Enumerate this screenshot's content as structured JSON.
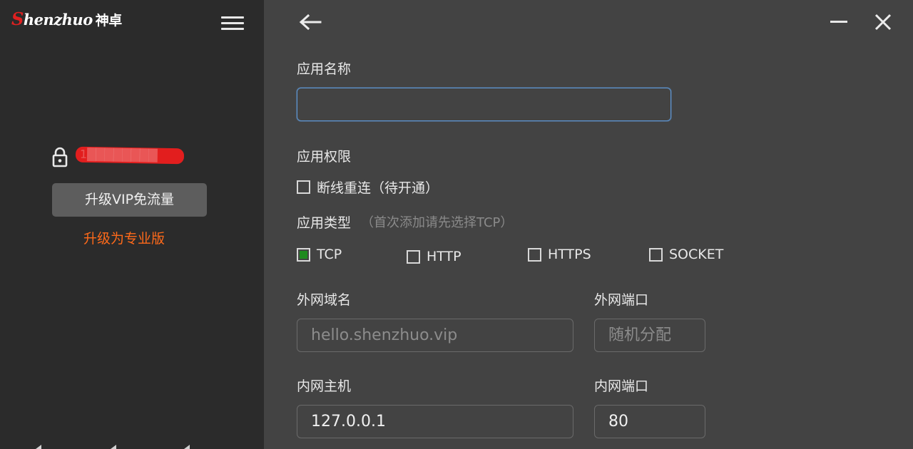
{
  "sidebar": {
    "logo": {
      "lead": "S",
      "rest": "henzhuo",
      "cn": "神卓"
    },
    "account_text": "1████████",
    "vip_button": "升级VIP免流量",
    "upgrade_link": "升级为专业版"
  },
  "form": {
    "app_name": {
      "label": "应用名称",
      "value": ""
    },
    "permission": {
      "label": "应用权限",
      "reconnect": "断线重连（待开通）"
    },
    "app_type": {
      "label": "应用类型",
      "hint": "（首次添加请先选择TCP）",
      "options": [
        {
          "label": "TCP",
          "checked": true
        },
        {
          "label": "HTTP",
          "checked": false
        },
        {
          "label": "HTTPS",
          "checked": false
        },
        {
          "label": "SOCKET",
          "checked": false
        }
      ]
    },
    "external_domain": {
      "label": "外网域名",
      "placeholder": "hello.shenzhuo.vip"
    },
    "external_port": {
      "label": "外网端口",
      "placeholder": "随机分配"
    },
    "internal_host": {
      "label": "内网主机",
      "value": "127.0.0.1"
    },
    "internal_port": {
      "label": "内网端口",
      "value": "80"
    }
  },
  "colors": {
    "accent_orange": "#ff6a1a",
    "checked_green": "#1e8a1e",
    "focus_blue": "#5f98d6",
    "logo_red": "#e02020"
  },
  "icons": [
    "menu-icon",
    "lock-icon",
    "back-arrow-icon",
    "minimize-icon",
    "close-icon"
  ]
}
